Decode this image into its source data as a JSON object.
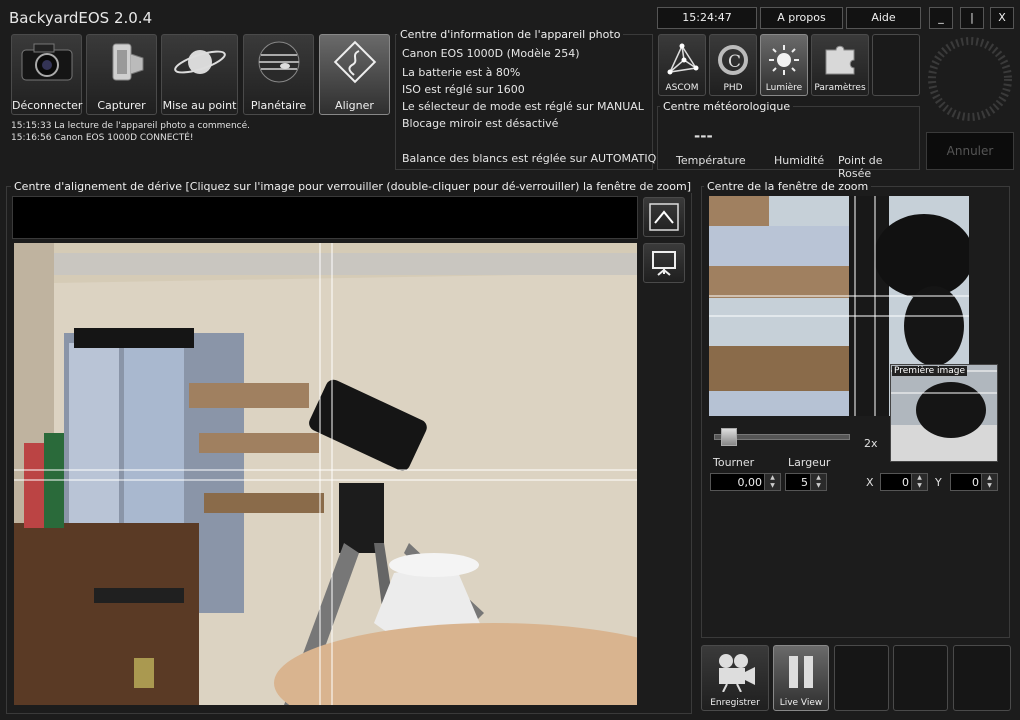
{
  "app": {
    "title": "BackyardEOS 2.0.4"
  },
  "top": {
    "time": "15:24:47",
    "about": "A propos",
    "help": "Aide",
    "minimize": "_",
    "restore": "|",
    "close": "X"
  },
  "modes": [
    {
      "label": "Déconnecter",
      "icon": "camera-icon"
    },
    {
      "label": "Capturer",
      "icon": "film-roll-icon"
    },
    {
      "label": "Mise au point",
      "icon": "planet-ring-icon"
    },
    {
      "label": "Planétaire",
      "icon": "jupiter-icon"
    },
    {
      "label": "Aligner",
      "icon": "align-icon"
    }
  ],
  "log": [
    "15:15:33  La lecture de l'appareil photo a commencé.",
    "15:16:56  Canon EOS 1000D CONNECTÉ!"
  ],
  "camera_info": {
    "title": "Centre d'information de l'appareil photo",
    "lines": [
      "Canon EOS 1000D    (Modèle 254)",
      "La batterie est à 80%",
      "ISO est réglé sur 1600",
      "Le sélecteur de mode est réglé sur MANUAL",
      "Blocage miroir est désactivé",
      "",
      "Balance des blancs est réglée sur AUTOMATIQUE"
    ]
  },
  "tools": [
    {
      "label": "ASCOM",
      "icon": "ascom-icon"
    },
    {
      "label": "PHD",
      "icon": "phd-icon"
    },
    {
      "label": "Lumière",
      "icon": "light-icon"
    },
    {
      "label": "Paramètres",
      "icon": "puzzle-icon"
    }
  ],
  "weather": {
    "title": "Centre météorologique",
    "value": "---",
    "temperature": "Température",
    "humidity": "Humidité",
    "dew_point": "Point de Rosée"
  },
  "cancel": "Annuler",
  "drift": {
    "title": "Centre d'alignement de dérive   [Cliquez sur l'image pour verrouiller (double-cliquer pour dé-verrouiller) la fenêtre de zoom]"
  },
  "zoom": {
    "title": "Centre de la fenêtre de zoom",
    "first_image": "Première image",
    "level": "2x",
    "level_fraction": 0.05,
    "rotate_label": "Tourner",
    "width_label": "Largeur",
    "rotate_value": "0,00",
    "width_value": "5",
    "x_label": "X",
    "x_value": "0",
    "y_label": "Y",
    "y_value": "0"
  },
  "bottom": {
    "record": "Enregistrer",
    "live_view": "Live View"
  }
}
